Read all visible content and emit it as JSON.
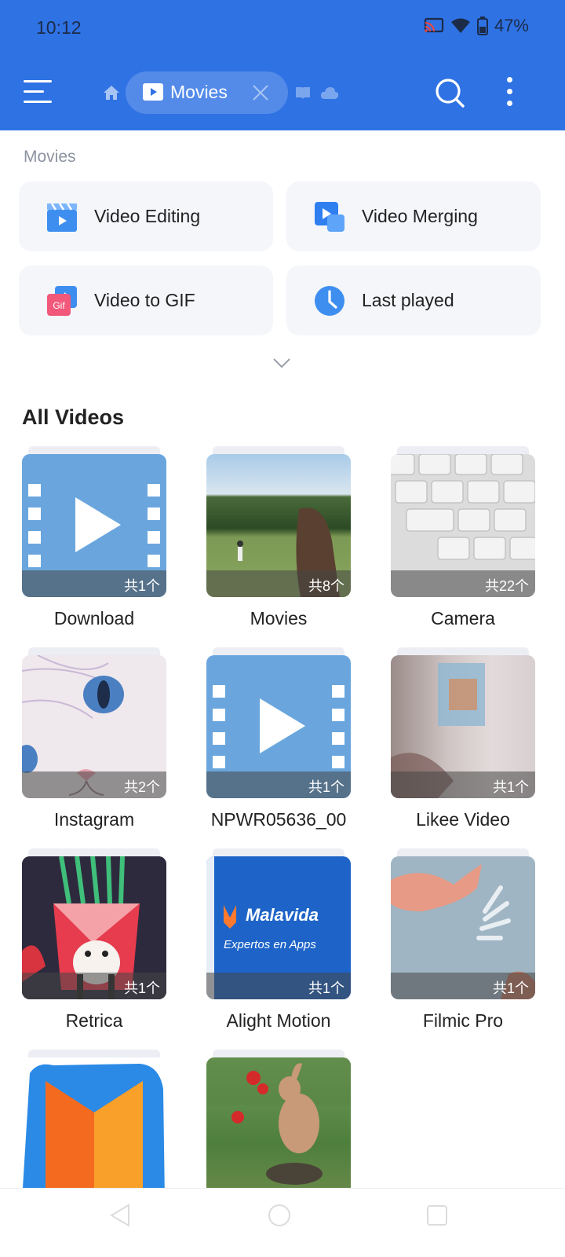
{
  "status_bar": {
    "time": "10:12",
    "battery": "47%"
  },
  "app_bar": {
    "menu_icon": "menu-icon",
    "home_icon": "home-icon",
    "tab_label": "Movies",
    "tab_icon": "video-icon",
    "close_icon": "close-icon",
    "book_icon": "book-icon",
    "cloud_icon": "cloud-icon",
    "search_icon": "search-icon",
    "more_icon": "more-vertical-icon",
    "color": "#2f72e4"
  },
  "section_label": "Movies",
  "tools": [
    {
      "label": "Video Editing",
      "icon": "clapperboard-icon"
    },
    {
      "label": "Video Merging",
      "icon": "video-merge-icon"
    },
    {
      "label": "Video to GIF",
      "icon": "gif-icon"
    },
    {
      "label": "Last played",
      "icon": "clock-icon"
    }
  ],
  "expand_icon": "chevron-down-icon",
  "all_videos_title": "All Videos",
  "folders": [
    {
      "name": "Download",
      "count": "共1个",
      "thumb": "generic-video"
    },
    {
      "name": "Movies",
      "count": "共8个",
      "thumb": "field-sky"
    },
    {
      "name": "Camera",
      "count": "共22个",
      "thumb": "keyboard"
    },
    {
      "name": "Instagram",
      "count": "共2个",
      "thumb": "cat-drawing"
    },
    {
      "name": "NPWR05636_00",
      "count": "共1个",
      "thumb": "generic-video"
    },
    {
      "name": "Likee Video",
      "count": "共1个",
      "thumb": "blurry-fabric"
    },
    {
      "name": "Retrica",
      "count": "共1个",
      "thumb": "fox-mug"
    },
    {
      "name": "Alight Motion",
      "count": "共1个",
      "thumb": "malavida-blue",
      "thumb_text": "Malavida",
      "thumb_subtext": "Expertos en Apps"
    },
    {
      "name": "Filmic Pro",
      "count": "共1个",
      "thumb": "fabric-fish"
    },
    {
      "name": "",
      "count": "",
      "thumb": "orange-m-logo"
    },
    {
      "name": "",
      "count": "",
      "thumb": "rabbit-strawberry"
    }
  ],
  "nav_bar": {
    "back_icon": "back-triangle-icon",
    "home_icon": "home-circle-icon",
    "recents_icon": "recents-square-icon"
  }
}
